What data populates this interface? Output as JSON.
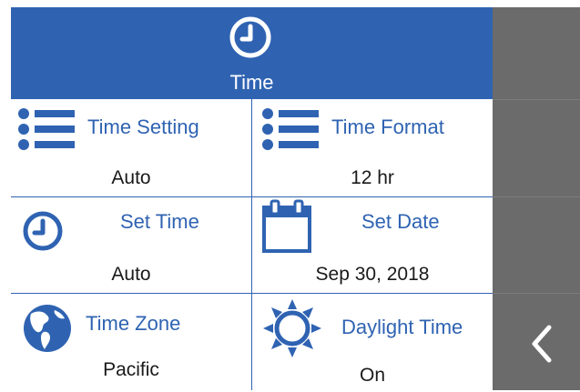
{
  "header": {
    "title": "Time",
    "icon": "clock-icon"
  },
  "cells": [
    {
      "label": "Time Setting",
      "value": "Auto",
      "icon": "list-icon"
    },
    {
      "label": "Time Format",
      "value": "12 hr",
      "icon": "list-icon"
    },
    {
      "label": "Set Time",
      "value": "Auto",
      "icon": "clock-icon"
    },
    {
      "label": "Set Date",
      "value": "Sep 30, 2018",
      "icon": "calendar-icon"
    },
    {
      "label": "Time Zone",
      "value": "Pacific",
      "icon": "globe-icon"
    },
    {
      "label": "Daylight Time",
      "value": "On",
      "icon": "sun-icon"
    }
  ],
  "sidebar": {
    "back_icon": "chevron-left-icon"
  },
  "colors": {
    "accent": "#2f63b2",
    "sidebar": "#6b6b6b",
    "text": "#1a1a1a",
    "white": "#ffffff"
  }
}
